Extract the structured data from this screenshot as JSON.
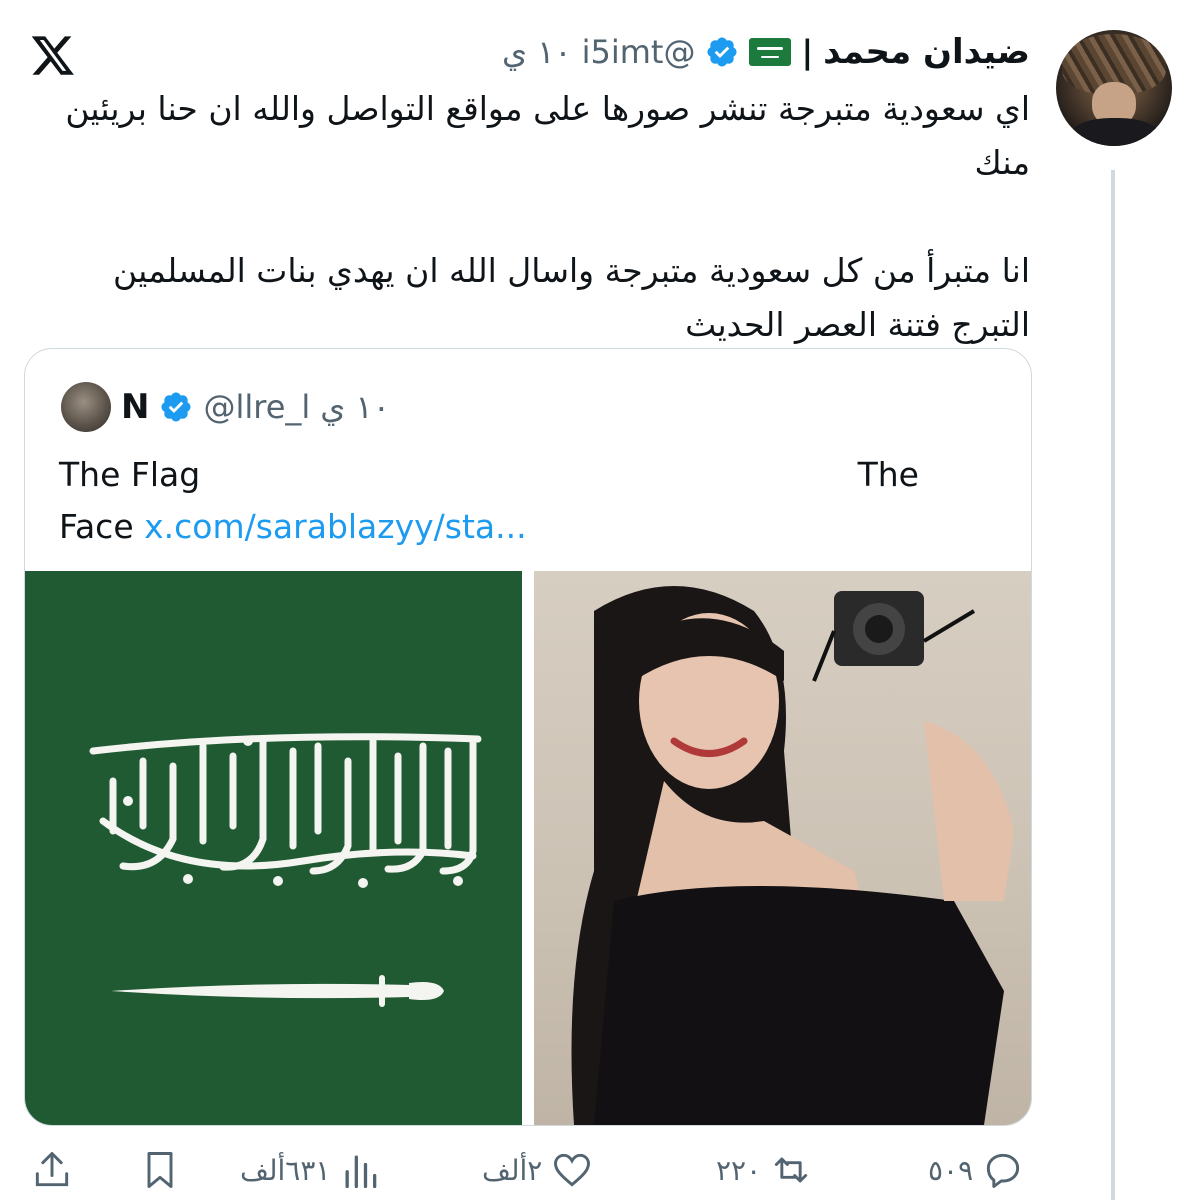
{
  "brand": {
    "logo_icon": "x-logo-icon"
  },
  "tweet": {
    "author_name": "ضيدان محمد",
    "separator": "|",
    "flag_emoji_icon": "saudi-flag-emoji",
    "verified_icon": "verified-badge-icon",
    "handle": "@i5imt",
    "time_ago": "١٠ ي",
    "text_paragraph_1": "اي سعودية متبرجة تنشر صورها على مواقع التواصل والله ان حنا بريئين منك",
    "text_paragraph_2": "انا متبرأ من كل سعودية متبرجة واسال الله ان يهدي بنات المسلمين التبرج فتنة العصر الحديث"
  },
  "quote": {
    "author_name": "N",
    "verified_icon": "verified-badge-icon",
    "handle": "@llre_l",
    "time_ago": "١٠ ي",
    "text_left": "The Flag",
    "text_right": "The",
    "text_line2_prefix": "Face",
    "link": "x.com/sarablazyy/sta...",
    "media": [
      "saudi-flag-image",
      "woman-with-camera-photo"
    ]
  },
  "actions": {
    "reply_count": "٥٠٩",
    "retweet_count": "٢٢٠",
    "like_count": "٢ألف",
    "views_count": "٦٣١ألف"
  },
  "colors": {
    "accent": "#1d9bf0",
    "muted": "#536471",
    "flag_green": "#205a33"
  }
}
